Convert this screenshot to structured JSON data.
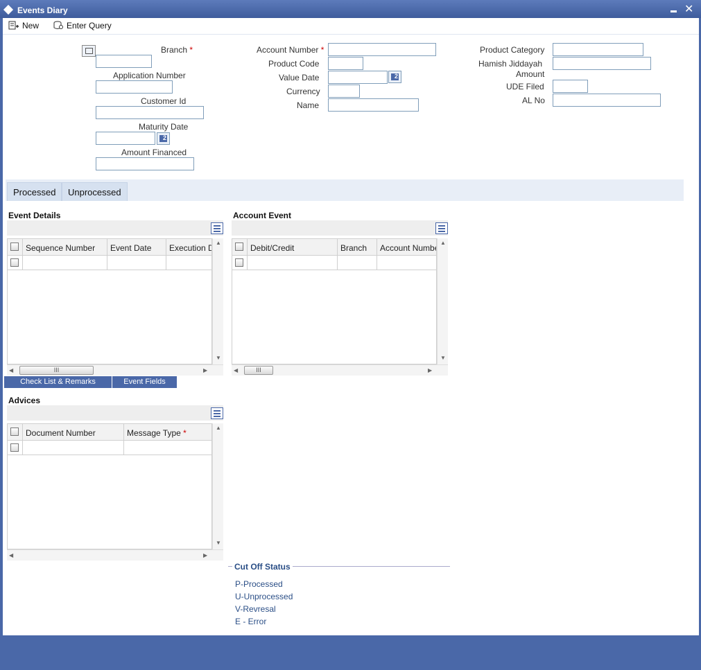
{
  "window": {
    "title": "Events Diary"
  },
  "toolbar": {
    "new_label": "New",
    "enter_query_label": "Enter Query"
  },
  "header": {
    "branch_label": "Branch",
    "application_number_label": "Application Number",
    "customer_id_label": "Customer Id",
    "maturity_date_label": "Maturity Date",
    "amount_financed_label": "Amount Financed",
    "account_number_label": "Account Number",
    "product_code_label": "Product Code",
    "value_date_label": "Value Date",
    "currency_label": "Currency",
    "name_label": "Name",
    "product_category_label": "Product Category",
    "hamish_jiddayah_label_line1": "Hamish Jiddayah",
    "hamish_jiddayah_label_line2": "Amount",
    "ude_filed_label": "UDE Filed",
    "al_no_label": "AL No",
    "required_mark": "*"
  },
  "tabs": [
    {
      "label": "Processed"
    },
    {
      "label": "Unprocessed"
    }
  ],
  "event_details": {
    "title": "Event Details",
    "columns": [
      "Sequence Number",
      "Event Date",
      "Execution D"
    ]
  },
  "account_event": {
    "title": "Account Event",
    "columns": [
      "Debit/Credit",
      "Branch",
      "Account Numbe"
    ]
  },
  "buttons": {
    "checklist_label": "Check List & Remarks",
    "event_fields_label": "Event Fields"
  },
  "advices": {
    "title": "Advices",
    "columns": [
      "Document Number",
      "Message Type"
    ]
  },
  "cutoff": {
    "title": "Cut Off Status",
    "items": [
      "P-Processed",
      "U-Unprocessed",
      "V-Revresal",
      "E - Error"
    ]
  },
  "scroll": {
    "thumb_grip": "III"
  },
  "colors": {
    "accent": "#4a68a8",
    "required": "#cc0000",
    "legend": "#2a4e86"
  }
}
